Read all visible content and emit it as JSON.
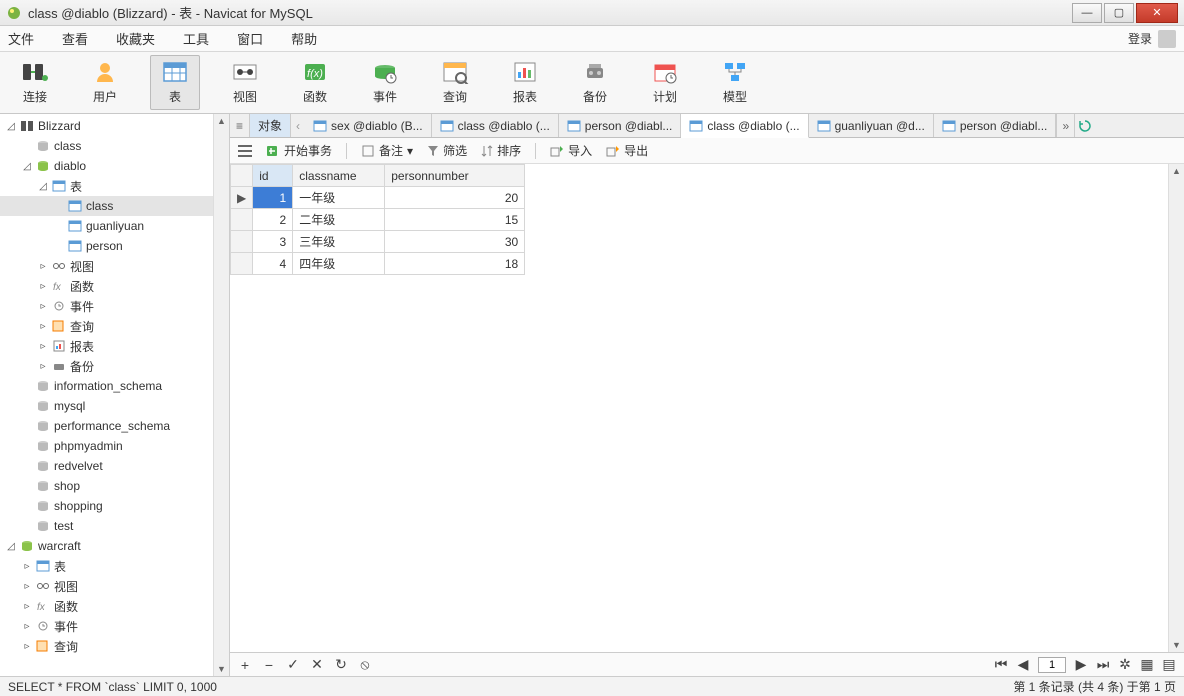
{
  "window": {
    "title": "class @diablo (Blizzard) - 表 - Navicat for MySQL"
  },
  "menu": {
    "items": [
      "文件",
      "查看",
      "收藏夹",
      "工具",
      "窗口",
      "帮助"
    ],
    "login": "登录"
  },
  "big_toolbar": {
    "items": [
      {
        "label": "连接",
        "icon": "connection"
      },
      {
        "label": "用户",
        "icon": "user"
      },
      {
        "label": "表",
        "icon": "table",
        "active": true
      },
      {
        "label": "视图",
        "icon": "view"
      },
      {
        "label": "函数",
        "icon": "function"
      },
      {
        "label": "事件",
        "icon": "event"
      },
      {
        "label": "查询",
        "icon": "query"
      },
      {
        "label": "报表",
        "icon": "report"
      },
      {
        "label": "备份",
        "icon": "backup"
      },
      {
        "label": "计划",
        "icon": "schedule"
      },
      {
        "label": "模型",
        "icon": "model"
      }
    ]
  },
  "tree": {
    "blizzard": "Blizzard",
    "blizzard_class": "class",
    "diablo": "diablo",
    "diablo_tables_label": "表",
    "diablo_tables": [
      "class",
      "guanliyuan",
      "person"
    ],
    "diablo_other": [
      "视图",
      "函数",
      "事件",
      "查询",
      "报表",
      "备份"
    ],
    "other_dbs": [
      "information_schema",
      "mysql",
      "performance_schema",
      "phpmyadmin",
      "redvelvet",
      "shop",
      "shopping",
      "test"
    ],
    "warcraft": "warcraft",
    "warcraft_children": [
      "表",
      "视图",
      "函数",
      "事件",
      "查询"
    ]
  },
  "tabs": {
    "first": "对象",
    "items": [
      "sex @diablo (B...",
      "class @diablo (...",
      "person @diabl...",
      "class @diablo (...",
      "guanliyuan @d...",
      "person @diabl..."
    ],
    "active_index": 3,
    "more": "»"
  },
  "table_toolbar": {
    "begin_tx": "开始事务",
    "note": "备注",
    "filter": "筛选",
    "sort": "排序",
    "import": "导入",
    "export": "导出"
  },
  "grid": {
    "columns": [
      "id",
      "classname",
      "personnumber"
    ],
    "rows": [
      {
        "id": 1,
        "classname": "一年级",
        "personnumber": 20,
        "selected": true
      },
      {
        "id": 2,
        "classname": "二年级",
        "personnumber": 15
      },
      {
        "id": 3,
        "classname": "三年级",
        "personnumber": 30
      },
      {
        "id": 4,
        "classname": "四年级",
        "personnumber": 18
      }
    ]
  },
  "footer": {
    "page": "1"
  },
  "status": {
    "sql": "SELECT * FROM `class` LIMIT 0, 1000",
    "record": "第 1 条记录 (共 4 条) 于第 1 页"
  }
}
